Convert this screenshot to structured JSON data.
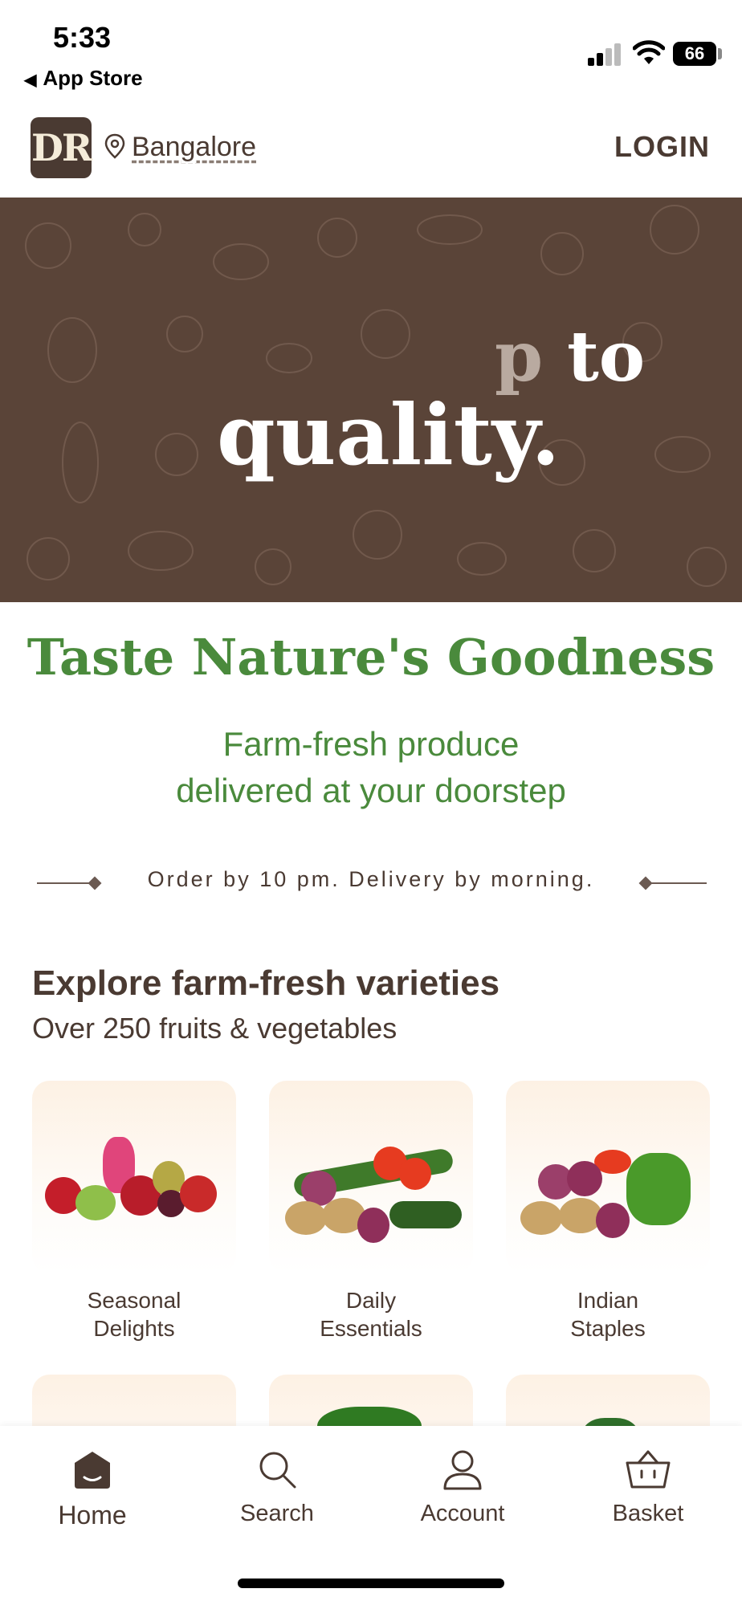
{
  "status_bar": {
    "time": "5:33",
    "back_label": "App Store",
    "battery": "66"
  },
  "header": {
    "logo_text": "DR",
    "location": "Bangalore",
    "login_label": "LOGIN"
  },
  "banner": {
    "line1_faded": "p",
    "line1": " to",
    "line2": "quality."
  },
  "hero": {
    "headline": "Taste Nature's Goodness",
    "subline1": "Farm-fresh produce",
    "subline2": "delivered at your doorstep",
    "order_note": "Order by 10 pm. Delivery by morning."
  },
  "explore": {
    "title": "Explore farm-fresh varieties",
    "subtitle": "Over 250 fruits & vegetables",
    "categories": [
      {
        "line1": "Seasonal",
        "line2": "Delights"
      },
      {
        "line1": "Daily",
        "line2": "Essentials"
      },
      {
        "line1": "Indian",
        "line2": "Staples"
      }
    ]
  },
  "bottom_nav": {
    "items": [
      {
        "label": "Home",
        "icon": "home-icon"
      },
      {
        "label": "Search",
        "icon": "search-icon"
      },
      {
        "label": "Account",
        "icon": "account-icon"
      },
      {
        "label": "Basket",
        "icon": "basket-icon"
      }
    ]
  },
  "colors": {
    "brand_brown": "#4a3a32",
    "banner_bg": "#5a4438",
    "accent_green": "#4a8a3c"
  }
}
